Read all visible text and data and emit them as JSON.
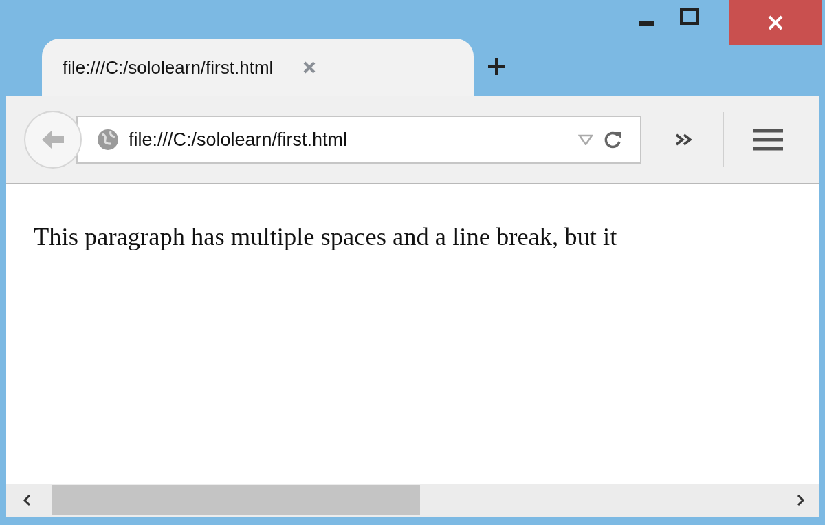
{
  "tabs": [
    {
      "label": "file:///C:/sololearn/first.html",
      "selected": true
    }
  ],
  "toolbar": {
    "address": "file:///C:/sololearn/first.html"
  },
  "page": {
    "paragraph": "This paragraph has multiple spaces and a line break, but it"
  }
}
